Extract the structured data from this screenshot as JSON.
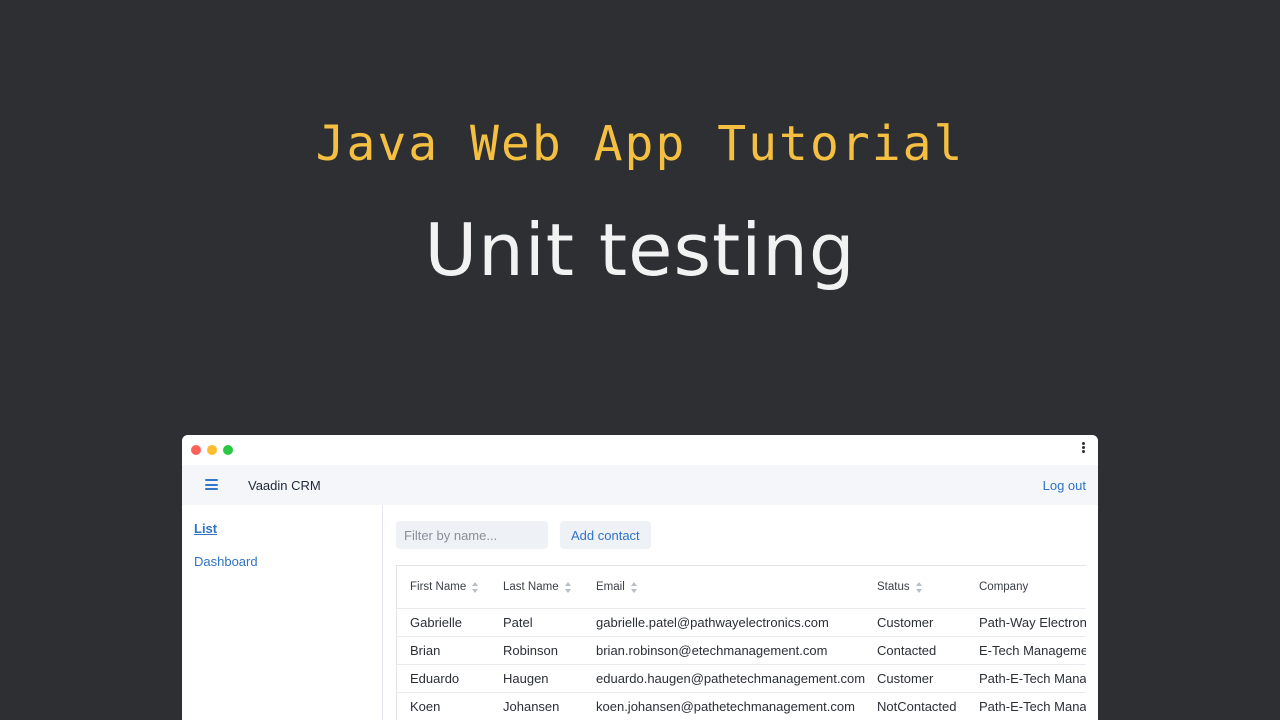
{
  "headline": {
    "subtitle": "Java Web App Tutorial",
    "title": "Unit testing"
  },
  "app": {
    "name": "Vaadin CRM",
    "logout_label": "Log out"
  },
  "drawer": {
    "items": [
      {
        "label": "List",
        "active": true
      },
      {
        "label": "Dashboard",
        "active": false
      }
    ]
  },
  "toolbar": {
    "filter_placeholder": "Filter by name...",
    "filter_value": "",
    "add_label": "Add contact"
  },
  "grid": {
    "columns": [
      "First Name",
      "Last Name",
      "Email",
      "Status",
      "Company"
    ],
    "sortable": [
      true,
      true,
      true,
      true,
      false
    ],
    "rows": [
      [
        "Gabrielle",
        "Patel",
        "gabrielle.patel@pathwayelectronics.com",
        "Customer",
        "Path-Way Electronics"
      ],
      [
        "Brian",
        "Robinson",
        "brian.robinson@etechmanagement.com",
        "Contacted",
        "E-Tech Management"
      ],
      [
        "Eduardo",
        "Haugen",
        "eduardo.haugen@pathetechmanagement.com",
        "Customer",
        "Path-E-Tech Management"
      ],
      [
        "Koen",
        "Johansen",
        "koen.johansen@pathetechmanagement.com",
        "NotContacted",
        "Path-E-Tech Management"
      ]
    ]
  },
  "colors": {
    "background": "#2d2f33",
    "subtitle": "#f5bf42",
    "title": "#f2f2f2",
    "link": "#2f73c5"
  }
}
